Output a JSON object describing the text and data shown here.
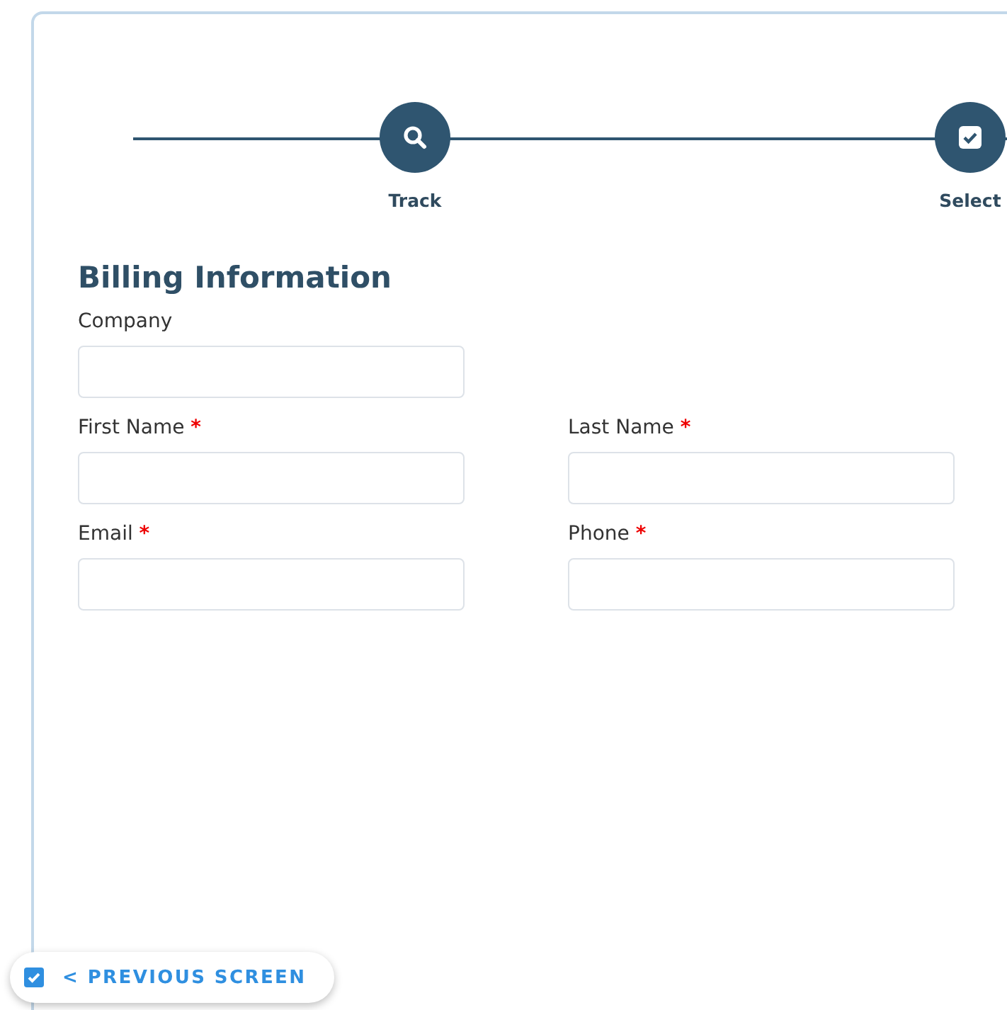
{
  "stepper": {
    "steps": [
      {
        "label": "Track",
        "kind": "search"
      },
      {
        "label": "Select",
        "kind": "check"
      }
    ]
  },
  "form": {
    "title": "Billing Information",
    "rows": [
      [
        {
          "label": "Company"
        }
      ],
      [
        {
          "label": "First Name",
          "required_mark": "*"
        },
        {
          "label": "Last Name",
          "required_mark": "*"
        }
      ],
      [
        {
          "label": "Email",
          "required_mark": "*"
        },
        {
          "label": "Phone",
          "required_mark": "*"
        }
      ]
    ]
  },
  "previous_button": {
    "label": "< PREVIOUS SCREEN",
    "checked": true
  }
}
